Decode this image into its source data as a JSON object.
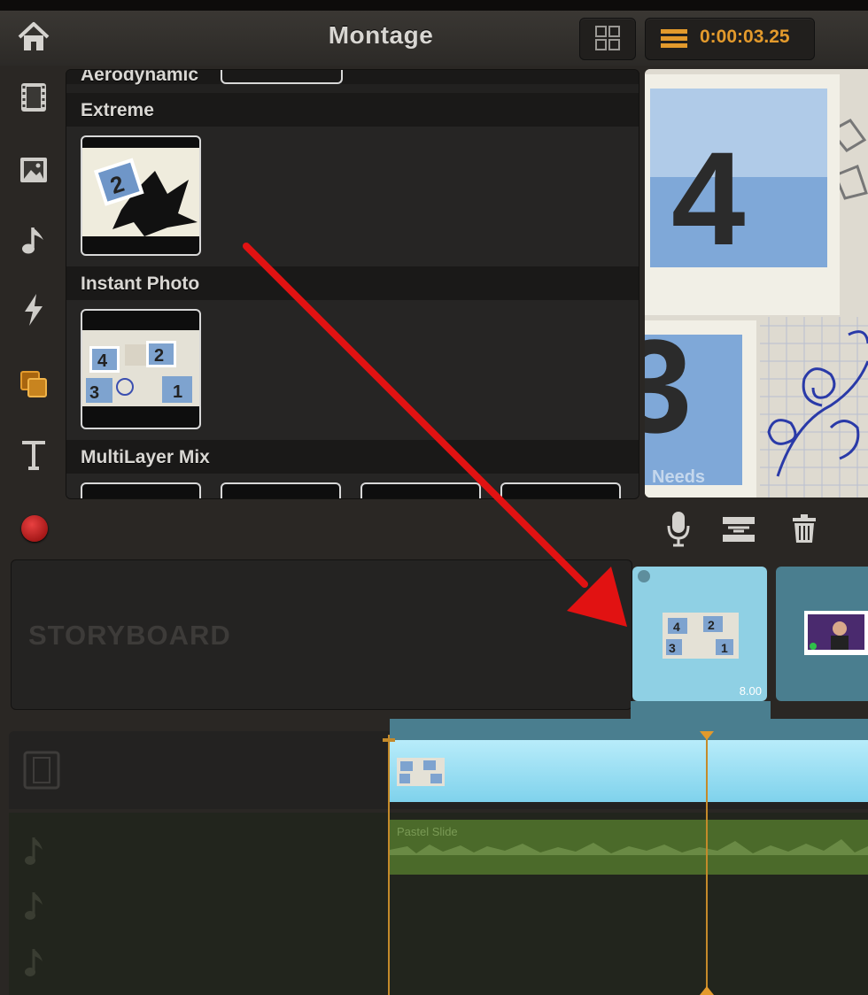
{
  "header": {
    "title": "Montage",
    "timecode": "0:00:03.25"
  },
  "sidebar": {
    "items": [
      {
        "icon": "home-icon"
      },
      {
        "icon": "film-icon"
      },
      {
        "icon": "photo-icon"
      },
      {
        "icon": "music-note-icon"
      },
      {
        "icon": "lightning-icon"
      },
      {
        "icon": "montage-layers-icon",
        "active": true
      },
      {
        "icon": "text-icon"
      }
    ]
  },
  "browser": {
    "categories": [
      {
        "label": "Aerodynamic"
      },
      {
        "label": "Extreme"
      },
      {
        "label": "Instant Photo"
      },
      {
        "label": "MultiLayer Mix"
      }
    ]
  },
  "preview": {
    "watermark": "Needs"
  },
  "storyboard": {
    "label": "STORYBOARD",
    "selected_clip_duration": "8.00"
  },
  "timeline": {
    "audio_clip_label": "Pastel Slide"
  },
  "colors": {
    "accent": "#e39a2c",
    "record": "#b01010",
    "clip_selected": "#8fd0e4",
    "arrow": "#e11212"
  }
}
